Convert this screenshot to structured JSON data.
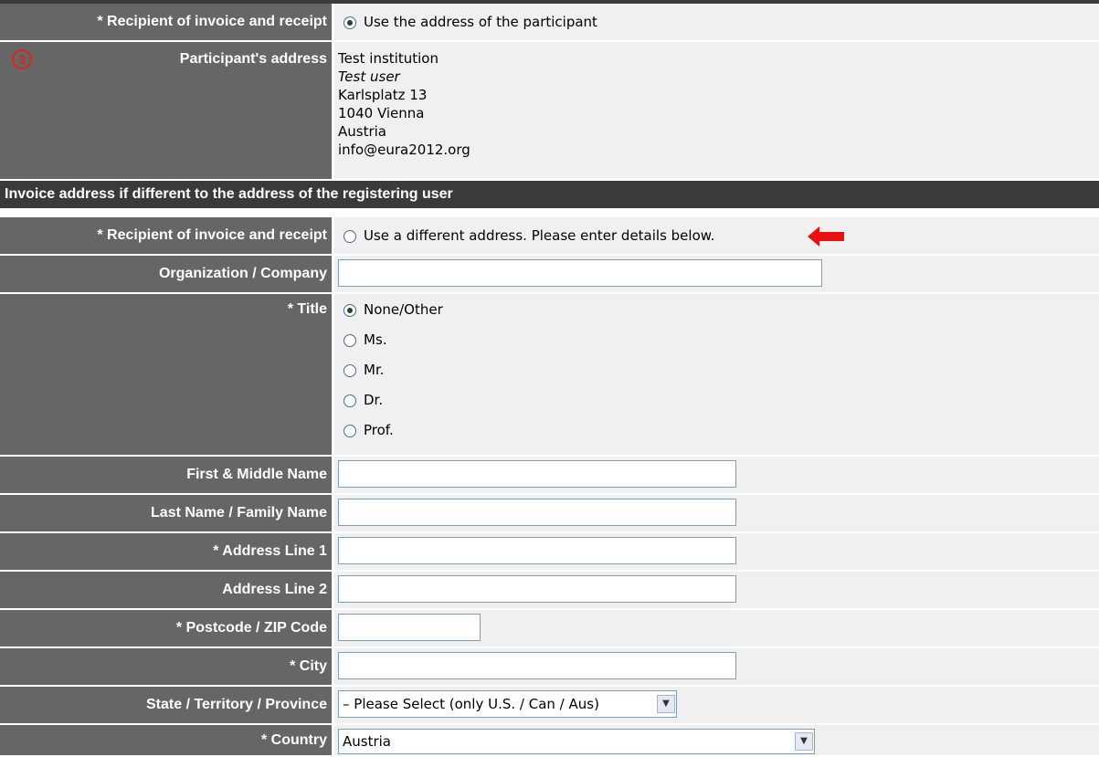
{
  "recipient_section": {
    "label": "* Recipient of invoice and receipt",
    "option_participant": "Use the address of the participant"
  },
  "participant_address": {
    "step_number": "3",
    "label": "Participant's address",
    "institution": "Test institution",
    "user": "Test user",
    "street": "Karlsplatz 13",
    "city_line": "1040 Vienna",
    "country": "Austria",
    "email": "info@eura2012.org"
  },
  "invoice_section": {
    "heading": "Invoice address if different to the address of the registering user",
    "recipient_label": "* Recipient of invoice and receipt",
    "option_different": "Use a different address. Please enter details below."
  },
  "fields": {
    "organization_label": "Organization / Company",
    "organization_value": "",
    "title_label": "* Title",
    "title_options": [
      "None/Other",
      "Ms.",
      "Mr.",
      "Dr.",
      "Prof."
    ],
    "title_selected": "None/Other",
    "first_name_label": "First & Middle Name",
    "first_name_value": "",
    "last_name_label": "Last Name / Family Name",
    "last_name_value": "",
    "address1_label": "* Address Line 1",
    "address1_value": "",
    "address2_label": "Address Line 2",
    "address2_value": "",
    "postcode_label": "* Postcode / ZIP Code",
    "postcode_value": "",
    "city_label": "* City",
    "city_value": "",
    "state_label": "State / Territory / Province",
    "state_value": "– Please Select (only U.S. / Can / Aus)",
    "country_label": "* Country",
    "country_value": "Austria"
  },
  "colors": {
    "label_bg": "#666666",
    "section_bg": "#3a3a3a",
    "value_bg": "#f0f0f0",
    "accent_red": "#e8110f"
  }
}
